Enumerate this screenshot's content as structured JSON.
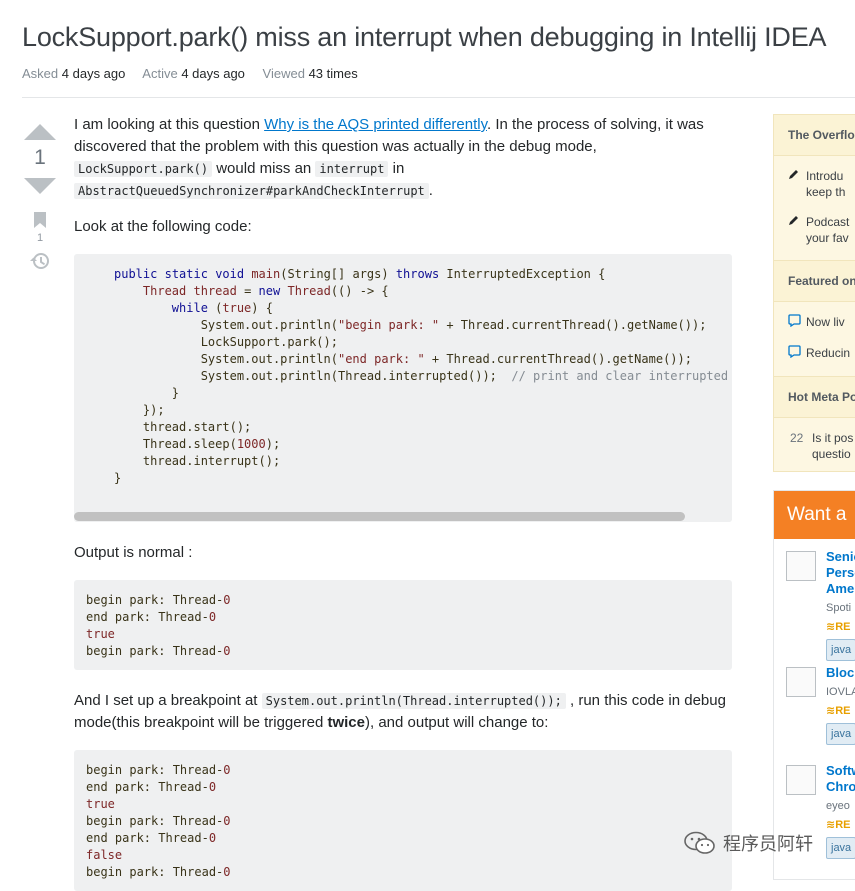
{
  "question": {
    "title": "LockSupport.park() miss an interrupt when debugging in Intellij IDEA",
    "meta": {
      "asked_label": "Asked",
      "asked_value": "4 days ago",
      "active_label": "Active",
      "active_value": "4 days ago",
      "viewed_label": "Viewed",
      "viewed_value": "43 times"
    },
    "votes": {
      "score": "1",
      "bookmarks": "1"
    },
    "body": {
      "p1_before": "I am looking at this question ",
      "p1_link": "Why is the AQS printed differently",
      "p1_after": ". In the process of solving, it was discovered that the problem with this question was actually in the debug mode, ",
      "p1_code1": "LockSupport.park()",
      "p1_mid": " would miss an ",
      "p1_code2": "interrupt",
      "p1_in": " in ",
      "p1_code3": "AbstractQueuedSynchronizer#parkAndCheckInterrupt",
      "p1_end": ".",
      "p2": "Look at the following code:",
      "code_lines": [
        [
          {
            "t": "kw",
            "v": "public"
          },
          {
            "t": "",
            "v": " "
          },
          {
            "t": "kw",
            "v": "static"
          },
          {
            "t": "",
            "v": " "
          },
          {
            "t": "kw",
            "v": "void"
          },
          {
            "t": "",
            "v": " "
          },
          {
            "t": "str",
            "v": "main"
          },
          {
            "t": "",
            "v": "(String[] args) "
          },
          {
            "t": "kw",
            "v": "throws"
          },
          {
            "t": "",
            "v": " InterruptedException {"
          }
        ],
        [
          {
            "t": "",
            "v": "    "
          },
          {
            "t": "str",
            "v": "Thread"
          },
          {
            "t": "",
            "v": " "
          },
          {
            "t": "str",
            "v": "thread"
          },
          {
            "t": "",
            "v": " = "
          },
          {
            "t": "kw",
            "v": "new"
          },
          {
            "t": "",
            "v": " "
          },
          {
            "t": "str",
            "v": "Thread"
          },
          {
            "t": "",
            "v": "(() -> {"
          }
        ],
        [
          {
            "t": "",
            "v": "        "
          },
          {
            "t": "kw",
            "v": "while"
          },
          {
            "t": "",
            "v": " ("
          },
          {
            "t": "lit",
            "v": "true"
          },
          {
            "t": "",
            "v": ") {"
          }
        ],
        [
          {
            "t": "",
            "v": "            System.out.println("
          },
          {
            "t": "str",
            "v": "\"begin park: \""
          },
          {
            "t": "",
            "v": " + Thread.currentThread().getName());"
          }
        ],
        [
          {
            "t": "",
            "v": "            LockSupport.park();"
          }
        ],
        [
          {
            "t": "",
            "v": "            System.out.println("
          },
          {
            "t": "str",
            "v": "\"end park: \""
          },
          {
            "t": "",
            "v": " + Thread.currentThread().getName());"
          }
        ],
        [
          {
            "t": "",
            "v": "            System.out.println(Thread.interrupted());  "
          },
          {
            "t": "cm",
            "v": "// print and clear interrupted s"
          }
        ],
        [
          {
            "t": "",
            "v": "        }"
          }
        ],
        [
          {
            "t": "",
            "v": "    });"
          }
        ],
        [
          {
            "t": "",
            "v": "    thread.start();"
          }
        ],
        [
          {
            "t": "",
            "v": "    Thread.sleep("
          },
          {
            "t": "num",
            "v": "1000"
          },
          {
            "t": "",
            "v": ");"
          }
        ],
        [
          {
            "t": "",
            "v": "    thread.interrupt();"
          }
        ],
        [
          {
            "t": "",
            "v": "}"
          }
        ]
      ],
      "p3": "Output is normal :",
      "output1": [
        [
          {
            "t": "",
            "v": "begin park: Thread-"
          },
          {
            "t": "num",
            "v": "0"
          }
        ],
        [
          {
            "t": "",
            "v": "end park: Thread-"
          },
          {
            "t": "num",
            "v": "0"
          }
        ],
        [
          {
            "t": "lit",
            "v": "true"
          }
        ],
        [
          {
            "t": "",
            "v": "begin park: Thread-"
          },
          {
            "t": "num",
            "v": "0"
          }
        ]
      ],
      "p4_before": "And I set up a breakpoint at ",
      "p4_code": "System.out.println(Thread.interrupted());",
      "p4_mid": " , run this code in debug mode(this breakpoint will be triggered ",
      "p4_bold": "twice",
      "p4_after": "), and output will change to:",
      "output2": [
        [
          {
            "t": "",
            "v": "begin park: Thread-"
          },
          {
            "t": "num",
            "v": "0"
          }
        ],
        [
          {
            "t": "",
            "v": "end park: Thread-"
          },
          {
            "t": "num",
            "v": "0"
          }
        ],
        [
          {
            "t": "lit",
            "v": "true"
          }
        ],
        [
          {
            "t": "",
            "v": "begin park: Thread-"
          },
          {
            "t": "num",
            "v": "0"
          }
        ],
        [
          {
            "t": "",
            "v": "end park: Thread-"
          },
          {
            "t": "num",
            "v": "0"
          }
        ],
        [
          {
            "t": "lit",
            "v": "false"
          }
        ],
        [
          {
            "t": "",
            "v": "begin park: Thread-"
          },
          {
            "t": "num",
            "v": "0"
          }
        ]
      ]
    }
  },
  "sidebar": {
    "blog_title": "The Overflo",
    "blog_items": [
      "Introdu",
      "keep th",
      "Podcast",
      "your fav"
    ],
    "featured_title": "Featured on",
    "featured_items": [
      "Now liv",
      "Reducin"
    ],
    "hot_title": "Hot Meta Po",
    "hot_count": "22",
    "hot_text_1": "Is it pos",
    "hot_text_2": "questio"
  },
  "jobs": {
    "header": "Want a",
    "items": [
      {
        "title1": "Senio",
        "title2": "Perso",
        "title3": "Amer",
        "company": "Spoti",
        "remote": "RE",
        "tag": "java"
      },
      {
        "title1": "Block",
        "company": "IOVLA",
        "remote": "RE",
        "tag": "java"
      },
      {
        "title1": "Softw",
        "title2": "Chro",
        "company": "eyeo",
        "remote": "RE",
        "tag": "java"
      }
    ]
  },
  "watermark": "程序员阿轩",
  "colors": {
    "link": "#0077cc",
    "accent": "#f48024",
    "code_bg": "#eff0f1",
    "sidebar_bg": "#fdf7e2"
  }
}
